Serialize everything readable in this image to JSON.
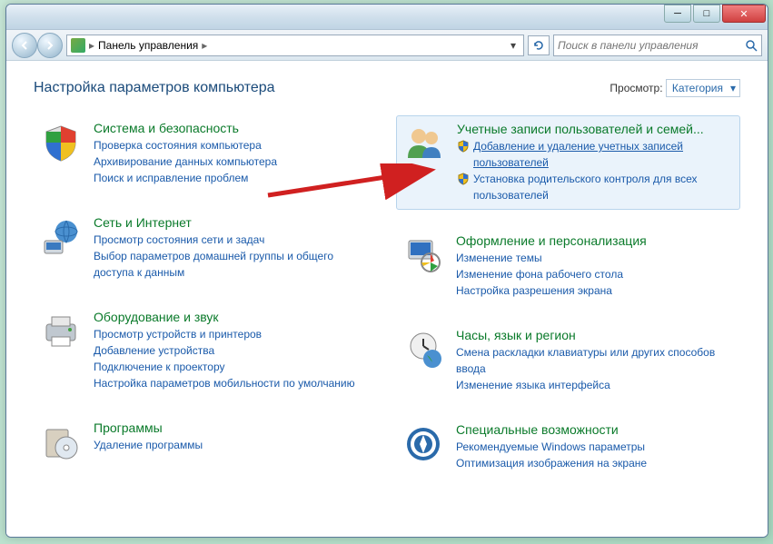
{
  "breadcrumb": {
    "home": "Панель управления"
  },
  "search": {
    "placeholder": "Поиск в панели управления"
  },
  "page": {
    "title": "Настройка параметров компьютера",
    "view_label": "Просмотр:",
    "view_value": "Категория"
  },
  "categories": {
    "left": [
      {
        "id": "system",
        "title": "Система и безопасность",
        "links": [
          "Проверка состояния компьютера",
          "Архивирование данных компьютера",
          "Поиск и исправление проблем"
        ]
      },
      {
        "id": "network",
        "title": "Сеть и Интернет",
        "links": [
          "Просмотр состояния сети и задач",
          "Выбор параметров домашней группы и общего доступа к данным"
        ]
      },
      {
        "id": "hardware",
        "title": "Оборудование и звук",
        "links": [
          "Просмотр устройств и принтеров",
          "Добавление устройства",
          "Подключение к проектору",
          "Настройка параметров мобильности по умолчанию"
        ]
      },
      {
        "id": "programs",
        "title": "Программы",
        "links": [
          "Удаление программы"
        ]
      }
    ],
    "right": [
      {
        "id": "accounts",
        "title": "Учетные записи пользователей и семей...",
        "highlight": true,
        "shield_links": [
          {
            "text": "Добавление и удаление учетных записей пользователей",
            "underlined": true
          },
          {
            "text": "Установка родительского контроля для всех пользователей",
            "underlined": false
          }
        ]
      },
      {
        "id": "appearance",
        "title": "Оформление и персонализация",
        "links": [
          "Изменение темы",
          "Изменение фона рабочего стола",
          "Настройка разрешения экрана"
        ]
      },
      {
        "id": "clock",
        "title": "Часы, язык и регион",
        "links": [
          "Смена раскладки клавиатуры или других способов ввода",
          "Изменение языка интерфейса"
        ]
      },
      {
        "id": "ease",
        "title": "Специальные возможности",
        "links": [
          "Рекомендуемые Windows параметры",
          "Оптимизация изображения на экране"
        ]
      }
    ]
  }
}
